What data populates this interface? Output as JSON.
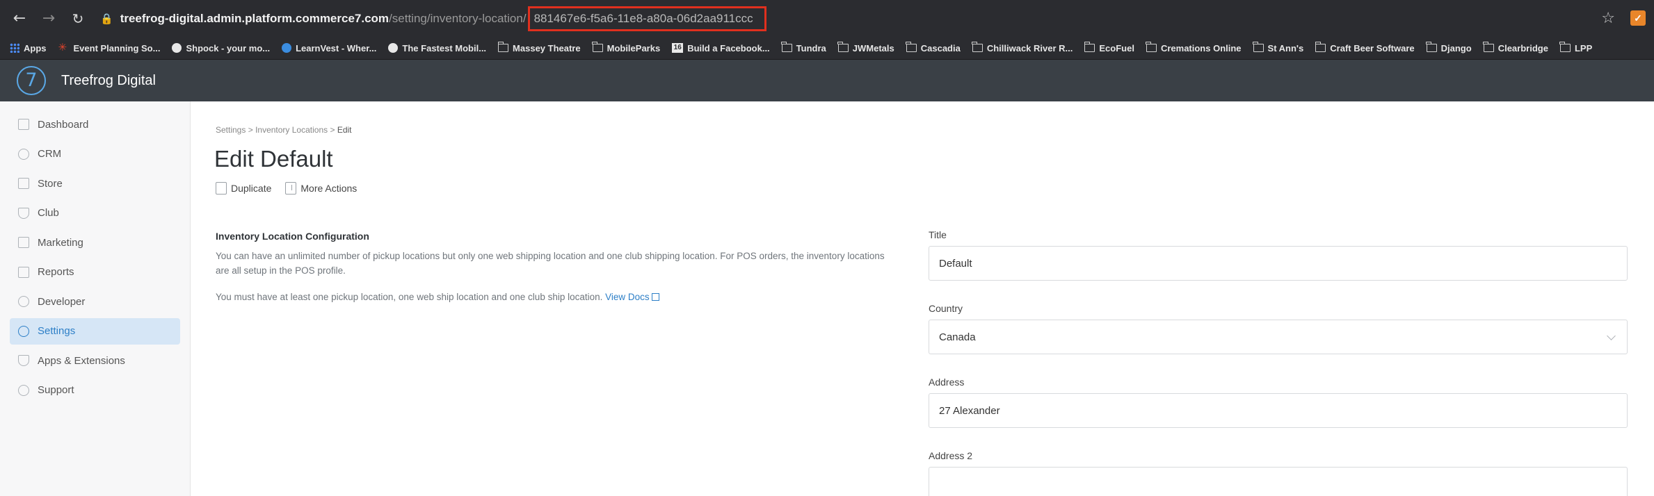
{
  "browser": {
    "url_host": "treefrog-digital.admin.platform.commerce7.com",
    "url_path": "/setting/inventory-location/",
    "url_highlighted_id": "881467e6-f5a6-11e8-a80a-06d2aa911ccc",
    "highlight_color": "#e0301e"
  },
  "bookmarks": [
    {
      "label": "Apps",
      "icon": "apps-grid-icon"
    },
    {
      "label": "Event Planning So...",
      "icon": "spark-icon"
    },
    {
      "label": "Shpock - your mo...",
      "icon": "globe-icon"
    },
    {
      "label": "LearnVest - Wher...",
      "icon": "blue-circle-icon"
    },
    {
      "label": "The Fastest Mobil...",
      "icon": "globe-icon"
    },
    {
      "label": "Massey Theatre",
      "icon": "folder-icon"
    },
    {
      "label": "MobileParks",
      "icon": "folder-icon"
    },
    {
      "label": "Build a Facebook...",
      "icon": "page-icon"
    },
    {
      "label": "Tundra",
      "icon": "folder-icon"
    },
    {
      "label": "JWMetals",
      "icon": "folder-icon"
    },
    {
      "label": "Cascadia",
      "icon": "folder-icon"
    },
    {
      "label": "Chilliwack River R...",
      "icon": "folder-icon"
    },
    {
      "label": "EcoFuel",
      "icon": "folder-icon"
    },
    {
      "label": "Cremations Online",
      "icon": "folder-icon"
    },
    {
      "label": "St Ann's",
      "icon": "folder-icon"
    },
    {
      "label": "Craft Beer Software",
      "icon": "folder-icon"
    },
    {
      "label": "Django",
      "icon": "folder-icon"
    },
    {
      "label": "Clearbridge",
      "icon": "folder-icon"
    },
    {
      "label": "LPP",
      "icon": "folder-icon"
    }
  ],
  "header": {
    "logo_text": "7",
    "org_name": "Treefrog Digital",
    "accent_color": "#5aa8e6"
  },
  "sidebar": {
    "items": [
      {
        "label": "Dashboard",
        "icon": "home-icon",
        "active": false
      },
      {
        "label": "CRM",
        "icon": "crm-icon",
        "active": false
      },
      {
        "label": "Store",
        "icon": "store-icon",
        "active": false
      },
      {
        "label": "Club",
        "icon": "club-icon",
        "active": false
      },
      {
        "label": "Marketing",
        "icon": "megaphone-icon",
        "active": false
      },
      {
        "label": "Reports",
        "icon": "chart-icon",
        "active": false
      },
      {
        "label": "Developer",
        "icon": "gear-icon",
        "active": false
      },
      {
        "label": "Settings",
        "icon": "settings-icon",
        "active": true
      },
      {
        "label": "Apps & Extensions",
        "icon": "flask-icon",
        "active": false
      },
      {
        "label": "Support",
        "icon": "chat-icon",
        "active": false
      }
    ]
  },
  "main": {
    "breadcrumb": {
      "items": [
        "Settings",
        "Inventory Locations",
        "Edit"
      ],
      "separator": ">"
    },
    "title": "Edit Default",
    "actions": {
      "duplicate": "Duplicate",
      "more_actions": "More Actions"
    },
    "config": {
      "heading": "Inventory Location Configuration",
      "description": "You can have an unlimited number of pickup locations but only one web shipping location and one club shipping location. For POS orders, the inventory locations are all setup in the POS profile.",
      "note": "You must have at least one pickup location, one web ship location and one club ship location.",
      "docs_link": "View Docs"
    },
    "form": {
      "title_label": "Title",
      "title_value": "Default",
      "country_label": "Country",
      "country_value": "Canada",
      "address_label": "Address",
      "address_value": "27 Alexander",
      "address2_label": "Address 2",
      "address2_value": ""
    }
  }
}
